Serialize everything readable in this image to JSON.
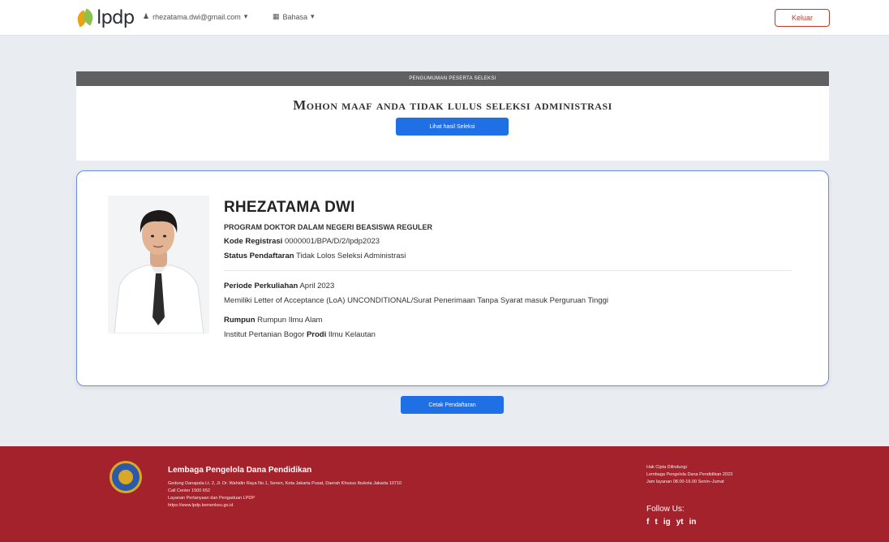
{
  "nav": {
    "logo_text": "lpdp",
    "user_email": "rhezatama.dwi@gmail.com",
    "language": "Bahasa",
    "logout_label": "Keluar"
  },
  "announcement": {
    "bar_text": "PENGUMUMAN PESERTA SELEKSI",
    "title": "Mohon maaf anda tidak lulus seleksi administrasi",
    "button_label": "Lihat hasil Seleksi"
  },
  "profile": {
    "name": "RHEZATAMA DWI",
    "program": "PROGRAM DOKTOR DALAM NEGERI BEASISWA REGULER",
    "reg_label": "Kode Registrasi",
    "reg_value": "0000001/BPA/D/2/lpdp2023",
    "status_label": "Status Pendaftaran",
    "status_value": "Tidak Lolos Seleksi Administrasi",
    "period_label": "Periode Perkuliahan",
    "period_value": "April 2023",
    "loa_text": "Memiliki Letter of Acceptance (LoA) UNCONDITIONAL/Surat Penerimaan Tanpa Syarat masuk Perguruan Tinggi",
    "rumpun_label": "Rumpun",
    "rumpun_value": "Rumpun Ilmu Alam",
    "university": "Institut Pertanian Bogor",
    "prodi_label": "Prodi",
    "prodi_value": "Ilmu Kelautan"
  },
  "print_button": "Cetak Pendaftaran",
  "footer": {
    "org_name": "Lembaga Pengelola Dana Pendidikan",
    "address": "Gedung Danapala Lt. 2, Jl. Dr. Wahidin Raya No.1, Senen, Kota Jakarta Pusat, Daerah Khusus Ibukota Jakarta 10710",
    "call_center": "Call Center 1500 652",
    "complaints": "Layanan Pertanyaan dan Pengaduan LPDP",
    "website": "https://www.lpdp.kemenkeu.go.id",
    "right_line1": "Hak Cipta Dilindungi",
    "right_line2": "Lembaga Pengelola Dana Pendidikan 2023",
    "right_line3": "Jam layanan 08.00-16.00 Senin–Jumat",
    "follow_label": "Follow Us:",
    "social": [
      "f",
      "t",
      "ig",
      "yt",
      "in"
    ]
  },
  "colors": {
    "primary": "#1f6fe5",
    "footer": "#a3222c",
    "danger": "#c0392b"
  }
}
